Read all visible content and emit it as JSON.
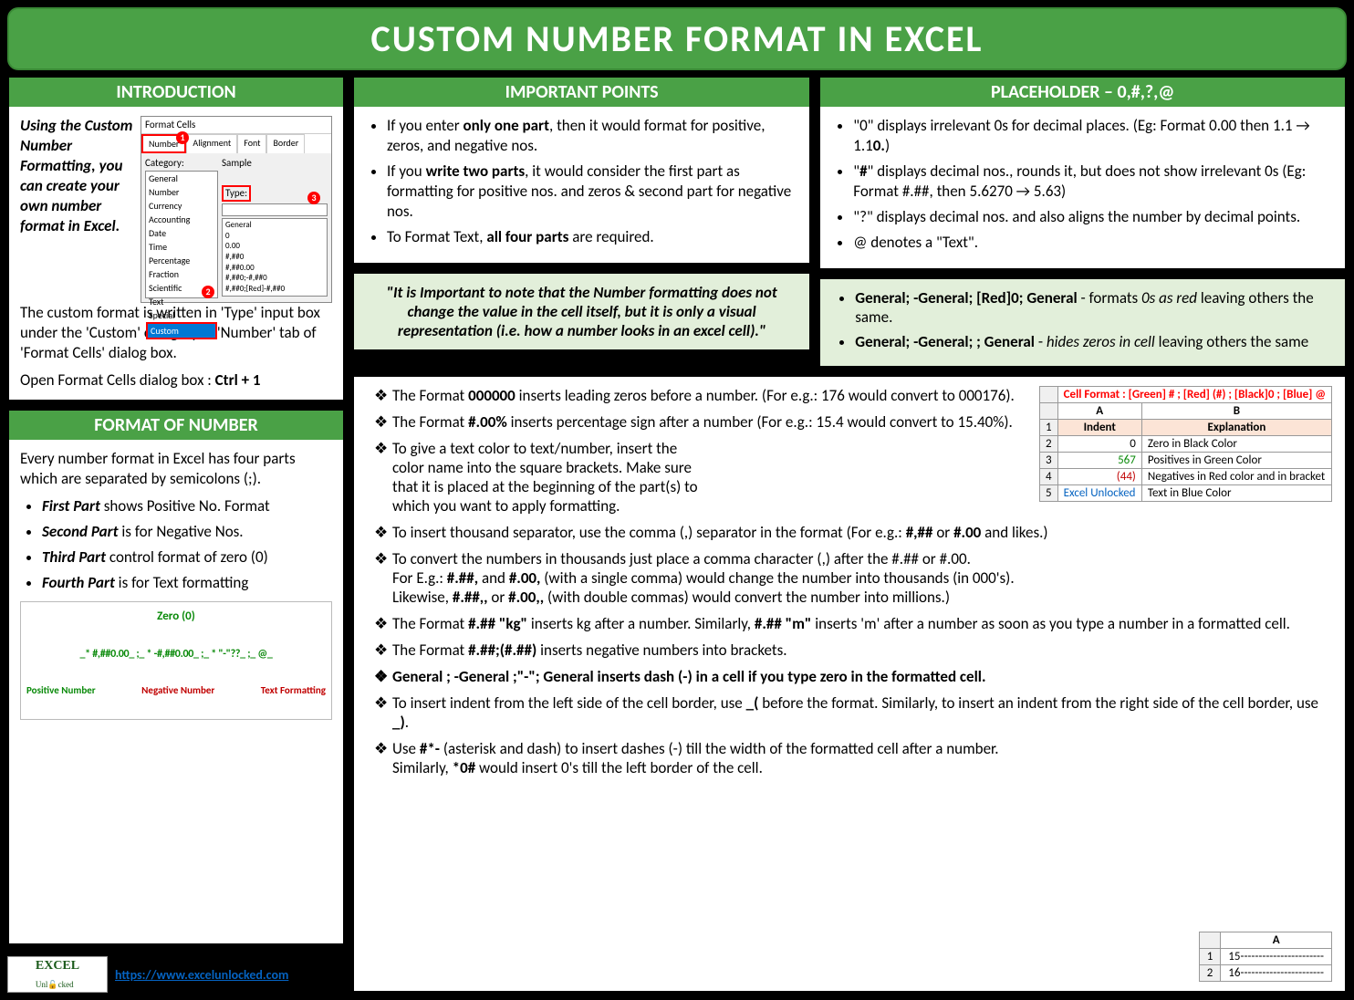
{
  "title": "CUSTOM NUMBER FORMAT IN EXCEL",
  "intro": {
    "heading": "INTRODUCTION",
    "lead": "Using the Custom Number Formatting, you can create your own number format in Excel.",
    "body": "The custom format is written in 'Type' input box under the 'Custom' category in 'Number' tab of 'Format Cells' dialog box.",
    "shortcut_prefix": "Open Format Cells dialog box : ",
    "shortcut": "Ctrl + 1",
    "dialog": {
      "title": "Format Cells",
      "tabs": [
        "Number",
        "Alignment",
        "Font",
        "Border"
      ],
      "category_label": "Category:",
      "categories": [
        "General",
        "Number",
        "Currency",
        "Accounting",
        "Date",
        "Time",
        "Percentage",
        "Fraction",
        "Scientific",
        "Text",
        "Special",
        "Custom"
      ],
      "sample_label": "Sample",
      "type_label": "Type:",
      "formats": [
        "General",
        "0",
        "0.00",
        "#,##0",
        "#,##0.00",
        "#,##0;-#,##0",
        "#,##0;[Red]-#,##0"
      ],
      "callouts": [
        "1",
        "2",
        "3"
      ]
    }
  },
  "format_number": {
    "heading": "FORMAT OF NUMBER",
    "intro": "Every number format in Excel has four parts which are separated by semicolons (;).",
    "parts": [
      {
        "b": "First Part",
        "t": " shows Positive No. Format"
      },
      {
        "b": "Second Part",
        "t": " is for Negative Nos."
      },
      {
        "b": "Third Part",
        "t": " control format of zero (0)"
      },
      {
        "b": "Fourth Part",
        "t": " is for Text formatting"
      }
    ],
    "diagram": {
      "zero": "Zero (0)",
      "code": "_* #,##0.00_ ;_ * -#,##0.00_ ;_ * \"-\"??_ ;_ @_",
      "labels": {
        "pos": "Positive Number",
        "neg": "Negative Number",
        "txt": "Text Formatting"
      }
    }
  },
  "important": {
    "heading": "IMPORTANT POINTS",
    "items": [
      "If you enter <b>only one part</b>, then it would format for positive, zeros, and negative nos.",
      "If you <b>write two parts</b>, it would consider the first part as formatting for positive nos. and zeros & second part for negative nos.",
      "To Format Text, <b>all four parts</b> are required."
    ],
    "note": "\"It is Important to note that the Number formatting does not change the value in the cell itself, but it is only a visual representation (i.e. how a number looks in an excel cell).\""
  },
  "placeholder": {
    "heading": "PLACEHOLDER – 0,#,?,@",
    "items": [
      "\"0\" displays irrelevant 0s for decimal places. (Eg: Format 0.00 then 1.1 → 1.1<b>0.</b>)",
      "\"<b>#</b>\" displays decimal nos., rounds it, but does not show irrelevant 0s (Eg: Format  #.##, then 5.6270 → 5.63)",
      "\"?\" displays decimal nos. and also aligns the number by decimal points.",
      "@ denotes a \"Text\"."
    ],
    "note_items": [
      "<b>General; -General; [Red]0; General</b> - formats <i>0s as red</i> leaving others the same.",
      "<b>General; -General; ; General</b> - <i>hides zeros in cell</i> leaving others the same"
    ]
  },
  "tips": [
    "The Format <b>000000</b> inserts leading zeros before a number. (For e.g.: 176 would convert to 000176).",
    "The Format <b>#.00%</b> inserts percentage sign after a number (For e.g.: 15.4 would convert to 15.40%).",
    "To give a text color to text/number, insert the color name into the square brackets. Make sure that it is placed at the beginning of the part(s) to which you want to apply formatting.",
    "To insert thousand separator, use the comma (,) separator in the format (For e.g.: <b>#,##</b> or <b>#.00</b> and likes.)",
    "To convert the numbers in thousands just place a comma character (,) after the #.## or #.00.<br>For E.g.: <b>#.##,</b> and <b>#.00,</b> (with a single comma) would change the number into thousands (in 000's).<br>Likewise, <b>#.##,,</b> or <b>#.00,,</b> (with double commas) would convert the number into millions.)",
    "The Format <b>#.## \"kg\"</b> inserts kg after a number. Similarly, <b>#.## \"m\"</b> inserts 'm' after a number as soon as you type a number in a formatted cell.",
    "The Format <b>#.##;(#.##)</b> inserts negative numbers into brackets.",
    "<b>General ; -General ;\"-\"; General</b> inserts dash (-) in a cell if you type zero in the formatted cell.",
    "To insert indent from the left side of the cell border, use <b>_(</b> before the format. Similarly, to insert an indent from the right side of the cell border, use <b>_)</b>.",
    "Use <b>#*-</b> (asterisk and dash) to insert dashes (-) till the width of the formatted cell after a number. Similarly, <b>*0#</b> would insert 0's till the left border of the cell."
  ],
  "color_example": {
    "title": "Cell Format : [Green] # ; [Red] (#) ; [Black]0 ; [Blue] @",
    "cols": [
      "A",
      "B"
    ],
    "headers": [
      "Indent",
      "Explanation"
    ],
    "rows": [
      {
        "n": "2",
        "a": "0",
        "ac": "#000",
        "b": "Zero in Black Color"
      },
      {
        "n": "3",
        "a": "567",
        "ac": "#0a8a0a",
        "b": "Positives in Green Color"
      },
      {
        "n": "4",
        "a": "(44)",
        "ac": "#c00000",
        "b": "Negatives in Red color and in bracket"
      },
      {
        "n": "5",
        "a": "Excel Unlocked",
        "ac": "#0563c1",
        "b": "Text in Blue Color"
      }
    ]
  },
  "dash_example": {
    "col": "A",
    "rows": [
      {
        "n": "1",
        "v": "15-----------------------"
      },
      {
        "n": "2",
        "v": "16-----------------------"
      }
    ]
  },
  "footer": {
    "url": "https://www.excelunlocked.com",
    "logo": "EXCEL",
    "logo_sub": "Unl🔓cked"
  }
}
